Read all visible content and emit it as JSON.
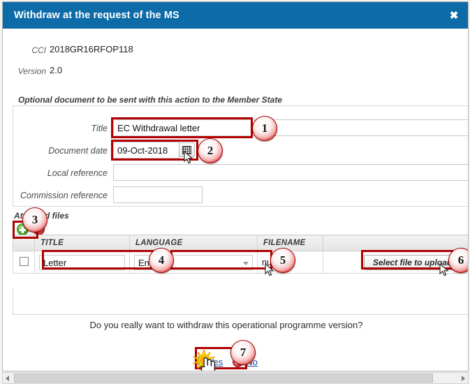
{
  "dialog": {
    "title": "Withdraw at the request of the MS",
    "close_label": "✖"
  },
  "meta": [
    {
      "label": "CCI",
      "value": "2018GR16RFOP118"
    },
    {
      "label": "Version",
      "value": "2.0"
    }
  ],
  "optional_document": {
    "legend": "Optional document to be sent with this action to the Member State",
    "fields": [
      {
        "label": "Title",
        "value": "EC Withdrawal letter",
        "placeholder": ""
      },
      {
        "label": "Document date",
        "value": "09-Oct-2018",
        "placeholder": ""
      },
      {
        "label": "Local reference",
        "value": "",
        "placeholder": ""
      },
      {
        "label": "Commission reference",
        "value": "",
        "placeholder": ""
      }
    ],
    "calendar_icon": "calendar-icon"
  },
  "attached_files": {
    "section_label": "Attached files",
    "add_icon": "add-icon",
    "remove_icon": "remove-icon",
    "columns": [
      "",
      "TITLE",
      "LANGUAGE",
      "FILENAME",
      ""
    ],
    "rows": [
      {
        "selected": false,
        "title": "Letter",
        "language": "English",
        "filename": "null",
        "upload_label": "Select file to upload"
      }
    ]
  },
  "confirm": {
    "question": "Do you really want to withdraw this operational programme version?",
    "yes_label": "Yes",
    "no_label": "No",
    "yes_icon": "check-circle-icon",
    "no_icon": "cross-circle-icon"
  },
  "annotations": [
    {
      "number": "1"
    },
    {
      "number": "2"
    },
    {
      "number": "3"
    },
    {
      "number": "4"
    },
    {
      "number": "5"
    },
    {
      "number": "6"
    },
    {
      "number": "7"
    }
  ],
  "colors": {
    "titlebar": "#0d6ba7",
    "annotation": "#b00000",
    "link": "#1b4fa0"
  }
}
